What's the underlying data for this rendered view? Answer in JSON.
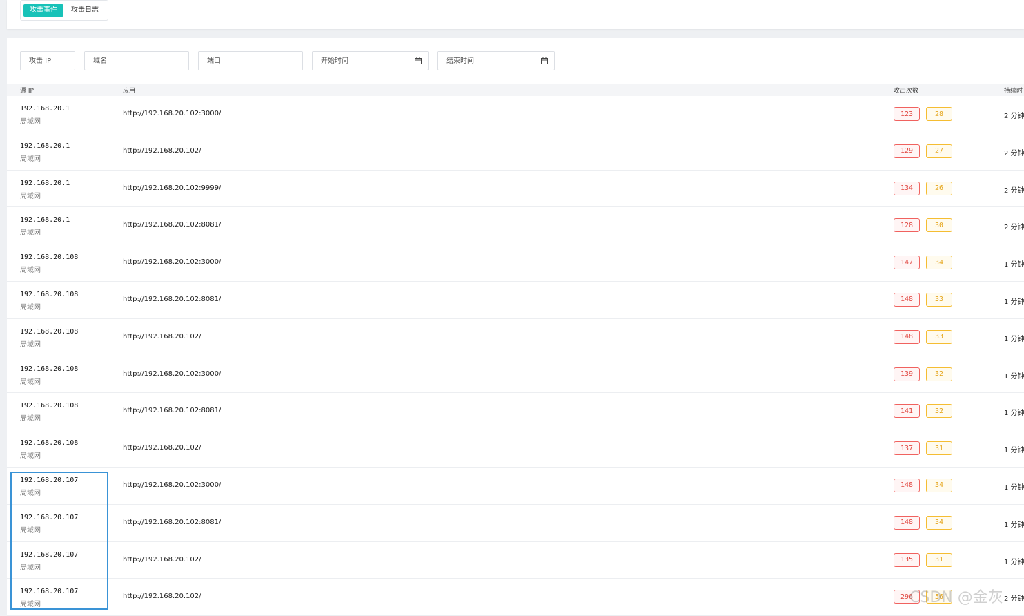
{
  "tabs": [
    {
      "label": "攻击事件",
      "active": true
    },
    {
      "label": "攻击日志",
      "active": false
    }
  ],
  "filters": {
    "attack_ip_placeholder": "攻击 IP",
    "domain_placeholder": "域名",
    "port_placeholder": "端口",
    "start_time_placeholder": "开始时间",
    "end_time_placeholder": "结束时间"
  },
  "table": {
    "headers": {
      "source_ip": "源 IP",
      "app": "应用",
      "attack_count": "攻击次数",
      "duration": "持续时"
    },
    "rows": [
      {
        "ip": "192.168.20.1",
        "net": "局域网",
        "app": "http://192.168.20.102:3000/",
        "count_a": "123",
        "count_b": "28",
        "duration": "2 分钟"
      },
      {
        "ip": "192.168.20.1",
        "net": "局域网",
        "app": "http://192.168.20.102/",
        "count_a": "129",
        "count_b": "27",
        "duration": "2 分钟"
      },
      {
        "ip": "192.168.20.1",
        "net": "局域网",
        "app": "http://192.168.20.102:9999/",
        "count_a": "134",
        "count_b": "26",
        "duration": "2 分钟"
      },
      {
        "ip": "192.168.20.1",
        "net": "局域网",
        "app": "http://192.168.20.102:8081/",
        "count_a": "128",
        "count_b": "30",
        "duration": "2 分钟"
      },
      {
        "ip": "192.168.20.108",
        "net": "局域网",
        "app": "http://192.168.20.102:3000/",
        "count_a": "147",
        "count_b": "34",
        "duration": "1 分钟"
      },
      {
        "ip": "192.168.20.108",
        "net": "局域网",
        "app": "http://192.168.20.102:8081/",
        "count_a": "148",
        "count_b": "33",
        "duration": "1 分钟"
      },
      {
        "ip": "192.168.20.108",
        "net": "局域网",
        "app": "http://192.168.20.102/",
        "count_a": "148",
        "count_b": "33",
        "duration": "1 分钟"
      },
      {
        "ip": "192.168.20.108",
        "net": "局域网",
        "app": "http://192.168.20.102:3000/",
        "count_a": "139",
        "count_b": "32",
        "duration": "1 分钟"
      },
      {
        "ip": "192.168.20.108",
        "net": "局域网",
        "app": "http://192.168.20.102:8081/",
        "count_a": "141",
        "count_b": "32",
        "duration": "1 分钟"
      },
      {
        "ip": "192.168.20.108",
        "net": "局域网",
        "app": "http://192.168.20.102/",
        "count_a": "137",
        "count_b": "31",
        "duration": "1 分钟"
      },
      {
        "ip": "192.168.20.107",
        "net": "局域网",
        "app": "http://192.168.20.102:3000/",
        "count_a": "148",
        "count_b": "34",
        "duration": "1 分钟"
      },
      {
        "ip": "192.168.20.107",
        "net": "局域网",
        "app": "http://192.168.20.102:8081/",
        "count_a": "148",
        "count_b": "34",
        "duration": "1 分钟"
      },
      {
        "ip": "192.168.20.107",
        "net": "局域网",
        "app": "http://192.168.20.102/",
        "count_a": "135",
        "count_b": "31",
        "duration": "1 分钟"
      },
      {
        "ip": "192.168.20.107",
        "net": "局域网",
        "app": "http://192.168.20.102/",
        "count_a": "296",
        "count_b": "56",
        "duration": "2 分钟"
      }
    ]
  },
  "watermark": "CSDN @金灰",
  "colors": {
    "accent": "#18c2b8",
    "badge_red": "#f0625f",
    "badge_yellow": "#f5bd32",
    "highlight": "#3a93d6"
  }
}
